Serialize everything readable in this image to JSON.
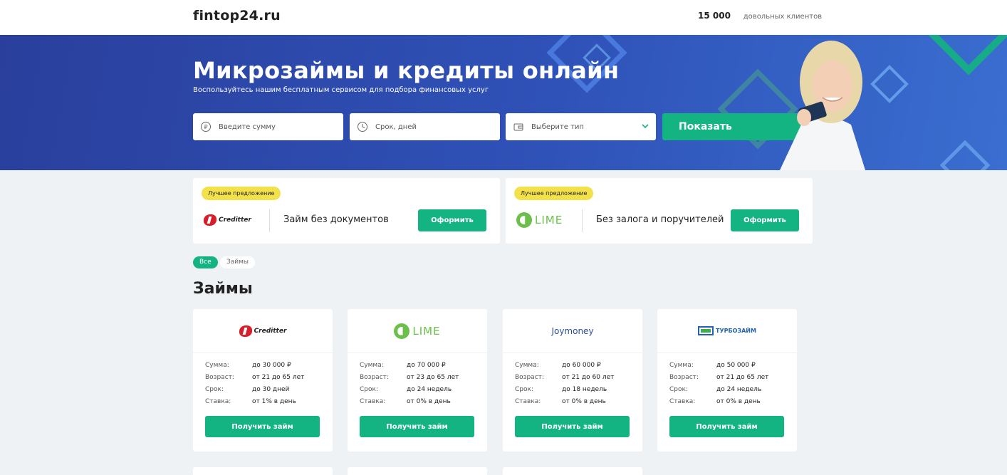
{
  "header": {
    "logo": "fintop24.ru",
    "clients_count": "15 000",
    "clients_label": "довольных клиентов"
  },
  "hero": {
    "title": "Микрозаймы и кредиты онлайн",
    "subtitle": "Воспользуйтесь нашим бесплатным сервисом для подбора финансовых услуг",
    "fields": {
      "amount_placeholder": "Введите сумму",
      "term_placeholder": "Срок, дней",
      "type_placeholder": "Выберите тип"
    },
    "show_label": "Показать"
  },
  "promos": [
    {
      "badge": "Лучшее предложение",
      "brand": "Creditter",
      "text": "Займ без документов",
      "button": "Оформить"
    },
    {
      "badge": "Лучшее предложение",
      "brand": "LIME",
      "text": "Без залога и поручителей",
      "button": "Оформить"
    }
  ],
  "filters": {
    "all": "Все",
    "loans": "Займы"
  },
  "section_title": "Займы",
  "labels": {
    "sum": "Сумма:",
    "age": "Возраст:",
    "term": "Срок:",
    "rate": "Ставка:"
  },
  "cards": [
    {
      "brand": "Creditter",
      "sum": "до 30 000 ₽",
      "age": "от 21 до 65 лет",
      "term": "до 30 дней",
      "rate": "от 1% в день",
      "button": "Получить займ"
    },
    {
      "brand": "LIME",
      "sum": "до 70 000 ₽",
      "age": "от 23 до 65 лет",
      "term": "до 24 недель",
      "rate": "от 0% в день",
      "button": "Получить займ"
    },
    {
      "brand": "Joymoney",
      "sum": "до 60 000 ₽",
      "age": "от 21 до 60 лет",
      "term": "до 18 недель",
      "rate": "от 0% в день",
      "button": "Получить займ"
    },
    {
      "brand": "ТУРБОЗАЙМ",
      "sum": "до 50 000 ₽",
      "age": "от 21 до 65 лет",
      "term": "до 24 недель",
      "rate": "от 0% в день",
      "button": "Получить займ"
    }
  ],
  "colors": {
    "accent": "#14b382",
    "hero": "#2f52b8",
    "badge": "#f3e14b"
  }
}
